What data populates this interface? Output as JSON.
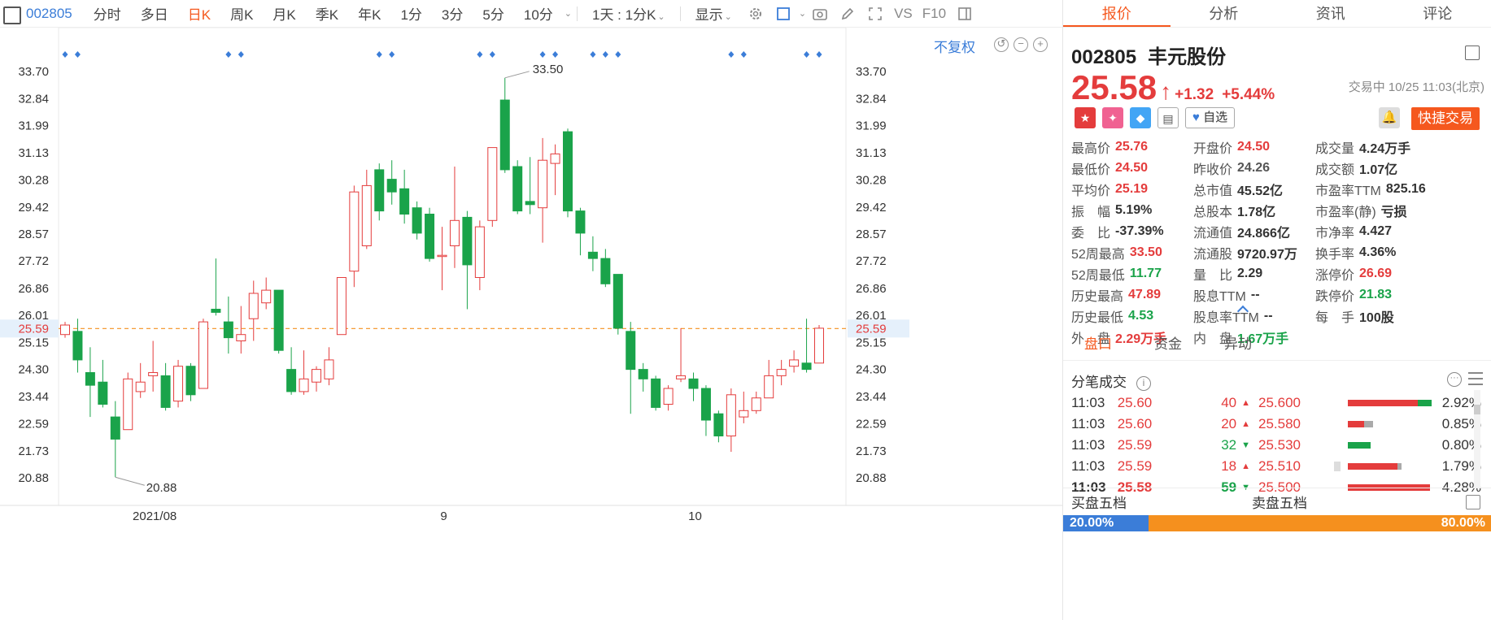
{
  "toolbar": {
    "code": "002805",
    "items": [
      "分时",
      "多日",
      "日K",
      "周K",
      "月K",
      "季K",
      "年K",
      "1分",
      "3分",
      "5分",
      "10分"
    ],
    "active": "日K",
    "period_select": "1天 : 1分K",
    "display": "显示",
    "vs_label": "VS",
    "f10_label": "F10"
  },
  "chart": {
    "adjust_label": "不复权",
    "high_label": "33.50",
    "low_label": "20.88",
    "current_label": "25.59",
    "colors": {
      "up": "#e43c3c",
      "down": "#1aa34a",
      "current": "#f5901e",
      "marker": "#3b7dd8"
    }
  },
  "chart_data": {
    "type": "candlestick",
    "y_ticks": [
      "33.70",
      "32.84",
      "31.99",
      "31.13",
      "30.28",
      "29.42",
      "28.57",
      "27.72",
      "26.86",
      "26.01",
      "25.15",
      "24.30",
      "23.44",
      "22.59",
      "21.73",
      "20.88"
    ],
    "y_range": [
      20.88,
      33.7
    ],
    "x_ticks": [
      {
        "label": "2021/08",
        "index": 7
      },
      {
        "label": "9",
        "index": 30
      },
      {
        "label": "10",
        "index": 50
      }
    ],
    "current_price": 25.59,
    "marker_indices": [
      0,
      1,
      13,
      14,
      25,
      26,
      33,
      34,
      38,
      39,
      42,
      43,
      44,
      53,
      54,
      59,
      60
    ],
    "candles": [
      {
        "o": 25.4,
        "c": 25.7,
        "h": 25.8,
        "l": 25.3
      },
      {
        "o": 25.5,
        "c": 24.6,
        "h": 25.9,
        "l": 24.2
      },
      {
        "o": 24.2,
        "c": 23.8,
        "h": 25.0,
        "l": 22.8
      },
      {
        "o": 23.9,
        "c": 23.2,
        "h": 24.6,
        "l": 23.1
      },
      {
        "o": 22.8,
        "c": 22.1,
        "h": 23.3,
        "l": 20.9
      },
      {
        "o": 22.4,
        "c": 24.0,
        "h": 24.2,
        "l": 22.4
      },
      {
        "o": 23.6,
        "c": 23.9,
        "h": 24.5,
        "l": 23.4
      },
      {
        "o": 24.1,
        "c": 24.2,
        "h": 25.2,
        "l": 23.6
      },
      {
        "o": 24.1,
        "c": 23.1,
        "h": 24.5,
        "l": 23.0
      },
      {
        "o": 23.3,
        "c": 24.4,
        "h": 24.6,
        "l": 23.1
      },
      {
        "o": 24.4,
        "c": 23.5,
        "h": 24.5,
        "l": 23.3
      },
      {
        "o": 23.7,
        "c": 25.8,
        "h": 25.9,
        "l": 23.7
      },
      {
        "o": 26.2,
        "c": 26.1,
        "h": 27.8,
        "l": 26.0
      },
      {
        "o": 25.8,
        "c": 25.3,
        "h": 26.6,
        "l": 24.8
      },
      {
        "o": 25.2,
        "c": 25.4,
        "h": 26.3,
        "l": 24.8
      },
      {
        "o": 25.9,
        "c": 26.7,
        "h": 27.1,
        "l": 25.2
      },
      {
        "o": 26.4,
        "c": 26.8,
        "h": 27.2,
        "l": 26.2
      },
      {
        "o": 26.8,
        "c": 24.9,
        "h": 26.8,
        "l": 24.8
      },
      {
        "o": 24.3,
        "c": 23.6,
        "h": 25.0,
        "l": 23.5
      },
      {
        "o": 23.6,
        "c": 24.0,
        "h": 24.9,
        "l": 23.5
      },
      {
        "o": 23.9,
        "c": 24.3,
        "h": 24.4,
        "l": 23.6
      },
      {
        "o": 24.0,
        "c": 24.6,
        "h": 25.0,
        "l": 23.8
      },
      {
        "o": 25.4,
        "c": 27.2,
        "h": 27.2,
        "l": 25.4
      },
      {
        "o": 27.4,
        "c": 29.9,
        "h": 30.1,
        "l": 26.9
      },
      {
        "o": 28.2,
        "c": 30.1,
        "h": 30.6,
        "l": 28.1
      },
      {
        "o": 30.6,
        "c": 29.3,
        "h": 30.8,
        "l": 29.0
      },
      {
        "o": 30.3,
        "c": 29.9,
        "h": 30.9,
        "l": 29.5
      },
      {
        "o": 30.0,
        "c": 29.2,
        "h": 30.6,
        "l": 28.9
      },
      {
        "o": 29.4,
        "c": 28.6,
        "h": 29.6,
        "l": 28.4
      },
      {
        "o": 29.2,
        "c": 27.8,
        "h": 29.4,
        "l": 27.7
      },
      {
        "o": 27.9,
        "c": 27.9,
        "h": 28.8,
        "l": 26.8
      },
      {
        "o": 28.2,
        "c": 29.0,
        "h": 30.7,
        "l": 27.5
      },
      {
        "o": 29.1,
        "c": 27.6,
        "h": 29.3,
        "l": 26.2
      },
      {
        "o": 27.2,
        "c": 28.8,
        "h": 29.0,
        "l": 26.8
      },
      {
        "o": 29.0,
        "c": 31.3,
        "h": 31.3,
        "l": 28.8
      },
      {
        "o": 32.8,
        "c": 30.6,
        "h": 33.5,
        "l": 30.5
      },
      {
        "o": 30.7,
        "c": 29.3,
        "h": 30.9,
        "l": 29.2
      },
      {
        "o": 29.6,
        "c": 29.5,
        "h": 31.0,
        "l": 29.2
      },
      {
        "o": 29.4,
        "c": 30.9,
        "h": 31.6,
        "l": 28.3
      },
      {
        "o": 30.8,
        "c": 31.1,
        "h": 31.4,
        "l": 29.8
      },
      {
        "o": 31.8,
        "c": 29.3,
        "h": 31.9,
        "l": 29.1
      },
      {
        "o": 29.3,
        "c": 28.6,
        "h": 29.4,
        "l": 27.9
      },
      {
        "o": 28.0,
        "c": 27.8,
        "h": 28.5,
        "l": 27.4
      },
      {
        "o": 27.8,
        "c": 27.0,
        "h": 28.1,
        "l": 26.9
      },
      {
        "o": 27.3,
        "c": 25.6,
        "h": 27.3,
        "l": 25.4
      },
      {
        "o": 25.5,
        "c": 24.3,
        "h": 25.8,
        "l": 22.9
      },
      {
        "o": 24.3,
        "c": 24.0,
        "h": 24.5,
        "l": 23.6
      },
      {
        "o": 24.0,
        "c": 23.1,
        "h": 24.1,
        "l": 23.0
      },
      {
        "o": 23.2,
        "c": 23.7,
        "h": 23.8,
        "l": 23.0
      },
      {
        "o": 24.0,
        "c": 24.1,
        "h": 25.6,
        "l": 23.9
      },
      {
        "o": 24.0,
        "c": 23.7,
        "h": 24.2,
        "l": 23.3
      },
      {
        "o": 23.7,
        "c": 22.7,
        "h": 23.8,
        "l": 22.2
      },
      {
        "o": 22.9,
        "c": 22.2,
        "h": 23.0,
        "l": 22.0
      },
      {
        "o": 22.2,
        "c": 23.5,
        "h": 23.7,
        "l": 21.7
      },
      {
        "o": 22.8,
        "c": 23.0,
        "h": 23.6,
        "l": 22.6
      },
      {
        "o": 23.0,
        "c": 23.4,
        "h": 23.6,
        "l": 22.9
      },
      {
        "o": 23.4,
        "c": 24.1,
        "h": 24.6,
        "l": 23.4
      },
      {
        "o": 24.1,
        "c": 24.3,
        "h": 24.6,
        "l": 23.8
      },
      {
        "o": 24.4,
        "c": 24.6,
        "h": 24.9,
        "l": 24.2
      },
      {
        "o": 24.5,
        "c": 24.3,
        "h": 25.9,
        "l": 24.2
      },
      {
        "o": 24.5,
        "c": 25.6,
        "h": 25.7,
        "l": 24.5
      }
    ]
  },
  "panel": {
    "tabs": [
      "报价",
      "分析",
      "资讯",
      "评论"
    ],
    "active_tab": "报价",
    "code": "002805",
    "name": "丰元股份",
    "price": "25.58",
    "change": "+1.32",
    "change_pct": "+5.44%",
    "trade_status": "交易中 10/25 11:03(北京)",
    "watch_label": "自选",
    "quick_trade": "快捷交易",
    "stats": [
      {
        "k": "最高价",
        "v": "25.76",
        "c": "red"
      },
      {
        "k": "开盘价",
        "v": "24.50",
        "c": "red"
      },
      {
        "k": "成交量",
        "v": "4.24万手",
        "c": ""
      },
      {
        "k": "最低价",
        "v": "24.50",
        "c": "red"
      },
      {
        "k": "昨收价",
        "v": "24.26",
        "c": "gray"
      },
      {
        "k": "成交额",
        "v": "1.07亿",
        "c": ""
      },
      {
        "k": "平均价",
        "v": "25.19",
        "c": "red"
      },
      {
        "k": "总市值",
        "v": "45.52亿",
        "c": ""
      },
      {
        "k": "市盈率TTM",
        "v": "825.16",
        "c": ""
      },
      {
        "k": "振　幅",
        "v": "5.19%",
        "c": ""
      },
      {
        "k": "总股本",
        "v": "1.78亿",
        "c": ""
      },
      {
        "k": "市盈率(静)",
        "v": "亏损",
        "c": ""
      },
      {
        "k": "委　比",
        "v": "-37.39%",
        "c": ""
      },
      {
        "k": "流通值",
        "v": "24.866亿",
        "c": ""
      },
      {
        "k": "市净率",
        "v": "4.427",
        "c": ""
      },
      {
        "k": "52周最高",
        "v": "33.50",
        "c": "red"
      },
      {
        "k": "流通股",
        "v": "9720.97万",
        "c": ""
      },
      {
        "k": "换手率",
        "v": "4.36%",
        "c": ""
      },
      {
        "k": "52周最低",
        "v": "11.77",
        "c": "green"
      },
      {
        "k": "量　比",
        "v": "2.29",
        "c": ""
      },
      {
        "k": "涨停价",
        "v": "26.69",
        "c": "red"
      },
      {
        "k": "历史最高",
        "v": "47.89",
        "c": "red"
      },
      {
        "k": "股息TTM",
        "v": "--",
        "c": ""
      },
      {
        "k": "跌停价",
        "v": "21.83",
        "c": "green"
      },
      {
        "k": "历史最低",
        "v": "4.53",
        "c": "green"
      },
      {
        "k": "股息率TTM",
        "v": "--",
        "c": ""
      },
      {
        "k": "每　手",
        "v": "100股",
        "c": ""
      },
      {
        "k": "外　盘",
        "v": "2.29万手",
        "c": "red"
      },
      {
        "k": "内　盘",
        "v": "1.67万手",
        "c": "green"
      }
    ],
    "subtabs": [
      "盘口",
      "资金",
      "异动"
    ],
    "active_subtab": "盘口",
    "trades_title": "分笔成交",
    "trades": [
      {
        "t": "11:03",
        "p": "25.60",
        "v": "40",
        "dir": "up"
      },
      {
        "t": "11:03",
        "p": "25.60",
        "v": "20",
        "dir": "up"
      },
      {
        "t": "11:03",
        "p": "25.59",
        "v": "32",
        "dir": "down"
      },
      {
        "t": "11:03",
        "p": "25.59",
        "v": "18",
        "dir": "up"
      },
      {
        "t": "11:03",
        "p": "25.58",
        "v": "59",
        "dir": "down"
      }
    ],
    "depth": [
      {
        "p": "25.600",
        "pct": "2.92%",
        "r": 0.85,
        "g": 0.15,
        "gr": 0
      },
      {
        "p": "25.580",
        "pct": "0.85%",
        "r": 0.2,
        "g": 0,
        "gr": 0.1
      },
      {
        "p": "25.530",
        "pct": "0.80%",
        "r": 0,
        "g": 0.25,
        "gr": 0
      },
      {
        "p": "25.510",
        "pct": "1.79%",
        "r": 0.6,
        "g": 0,
        "gr": 0.05
      },
      {
        "p": "25.500",
        "pct": "4.28%",
        "r": 1.0,
        "g": 0,
        "gr": 0
      }
    ],
    "bid_label": "买盘五档",
    "ask_label": "卖盘五档",
    "bid_pct": "20.00%",
    "ask_pct": "80.00%"
  }
}
